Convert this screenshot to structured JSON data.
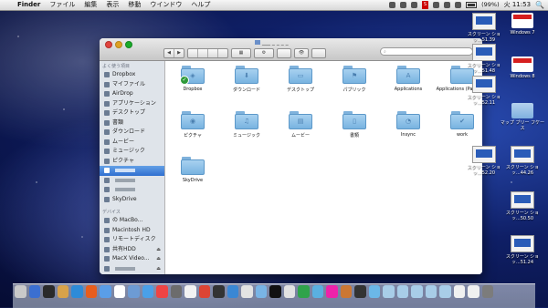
{
  "menubar": {
    "apple": "",
    "items": [
      "Finder",
      "ファイル",
      "編集",
      "表示",
      "移動",
      "ウインドウ",
      "ヘルプ"
    ],
    "status_red": "S",
    "battery": "(99%)",
    "clock": "火 11:53",
    "spotlight": "🔍"
  },
  "window": {
    "title": "___ _ _ _ _",
    "toolbar": {
      "back": "◀",
      "forward": "▶",
      "action": "⚙",
      "arrange": "▦",
      "eye": "👁"
    },
    "search_placeholder": "",
    "search_icon": "search-icon",
    "sidebar": {
      "favorites_header": "よく使う項目",
      "favorites": [
        {
          "label": "Dropbox",
          "icon": "dropbox-icon"
        },
        {
          "label": "マイファイル",
          "icon": "allfiles-icon"
        },
        {
          "label": "AirDrop",
          "icon": "airdrop-icon"
        },
        {
          "label": "アプリケーション",
          "icon": "applications-icon"
        },
        {
          "label": "デスクトップ",
          "icon": "desktop-icon"
        },
        {
          "label": "書類",
          "icon": "documents-icon"
        },
        {
          "label": "ダウンロード",
          "icon": "downloads-icon"
        },
        {
          "label": "ムービー",
          "icon": "movies-icon"
        },
        {
          "label": "ミュージック",
          "icon": "music-icon"
        },
        {
          "label": "ピクチャ",
          "icon": "pictures-icon"
        },
        {
          "label": "",
          "icon": "home-icon",
          "selected": true
        },
        {
          "label": "",
          "icon": "folder-icon"
        },
        {
          "label": "",
          "icon": "folder-icon"
        },
        {
          "label": "SkyDrive",
          "icon": "skydrive-icon"
        }
      ],
      "devices_header": "デバイス",
      "devices": [
        {
          "label": "の MacBo...",
          "icon": "laptop-icon",
          "eject": false
        },
        {
          "label": "Macintosh HD",
          "icon": "hdd-icon",
          "eject": false
        },
        {
          "label": "リモートディスク",
          "icon": "remote-disc-icon",
          "eject": false
        },
        {
          "label": "共有HDD",
          "icon": "drive-icon",
          "eject": true
        },
        {
          "label": "MacX Video...",
          "icon": "drive-icon",
          "eject": true
        },
        {
          "label": "",
          "icon": "drive-icon",
          "eject": true
        }
      ]
    },
    "files": [
      {
        "label": "Dropbox",
        "glyph": "◈",
        "check": true
      },
      {
        "label": "ダウンロード",
        "glyph": "⬇"
      },
      {
        "label": "デスクトップ",
        "glyph": "▭"
      },
      {
        "label": "パブリック",
        "glyph": "⚑"
      },
      {
        "label": "Applications",
        "glyph": "A"
      },
      {
        "label": "Applications (Parallels)",
        "glyph": ""
      },
      {
        "label": "ピクチャ",
        "glyph": "◉"
      },
      {
        "label": "ミュージック",
        "glyph": "♫"
      },
      {
        "label": "ムービー",
        "glyph": "▤"
      },
      {
        "label": "書類",
        "glyph": "▯"
      },
      {
        "label": "Insync",
        "glyph": "◔"
      },
      {
        "label": "work",
        "glyph": "✔"
      },
      {
        "label": "SkyDrive",
        "glyph": ""
      }
    ]
  },
  "desktop": [
    {
      "label": "スクリーン ショッ...51.39",
      "type": "shot"
    },
    {
      "label": "Windows 7",
      "type": "pv"
    },
    {
      "label": "スクリーン ショッ...51.48",
      "type": "shot"
    },
    {
      "label": "Windows 8",
      "type": "pv"
    },
    {
      "label": "スクリーン ショッ...52.11",
      "type": "shot"
    },
    {
      "label": "マップ ブリー フケース",
      "type": "folder"
    },
    {
      "label": "スクリーン ショッ...52.20",
      "type": "shot"
    },
    {
      "label": "スクリーン ショッ...44.26",
      "type": "shot"
    },
    {
      "label": "スクリーン ショッ...50.50",
      "type": "shot"
    },
    {
      "label": "スクリーン ショッ...51.24",
      "type": "shot"
    }
  ],
  "dock": [
    "#c9c9c9",
    "#3b6fd1",
    "#2a2a2a",
    "#d8a24a",
    "#2d8bd8",
    "#e85d1c",
    "#5a9ee8",
    "#ffffff",
    "#6d9bd4",
    "#4aa0e8",
    "#e44",
    "#6c6c6c",
    "#f2f2f2",
    "#d43",
    "#333",
    "#3a87d4",
    "#e3e3e3",
    "#79b4e5",
    "#111",
    "#e2e2e2",
    "#2fa34a",
    "#5ab0e0",
    "#e2a",
    "#c73",
    "#333",
    "#6bb7e8",
    "#a8cde8",
    "#a8cde8",
    "#a8cde8",
    "#a8cde8",
    "#a8cde8",
    "#f0f0f0",
    "#f0f0f0",
    "#7c7c7c"
  ]
}
